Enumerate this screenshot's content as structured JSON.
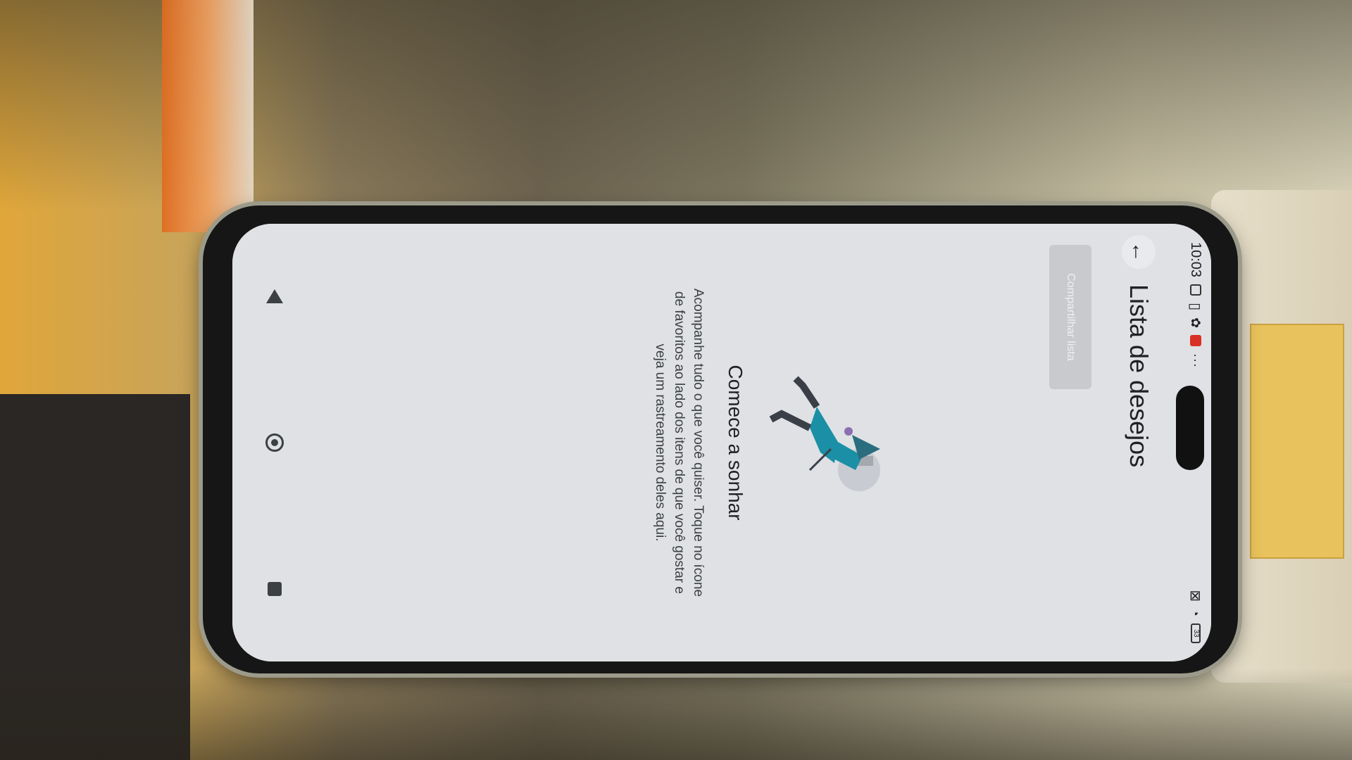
{
  "status_bar": {
    "time": "10:03",
    "battery": "33"
  },
  "app_bar": {
    "title": "Lista de desejos",
    "back_icon": "arrow-left-icon"
  },
  "share_button": {
    "label": "Compartilhar lista"
  },
  "empty_state": {
    "title": "Comece a sonhar",
    "body": "Acompanhe tudo o que você quiser. Toque no ícone de favoritos ao lado dos itens de que você gostar e veja um rastreamento deles aqui."
  },
  "nav_bar": {
    "back_icon": "triangle-back-icon",
    "home_icon": "circle-home-icon",
    "recents_icon": "square-recents-icon"
  },
  "colors": {
    "screen_bg": "#dfe1e4",
    "accent_teal": "#1b8fa6",
    "text_primary": "#202124"
  }
}
